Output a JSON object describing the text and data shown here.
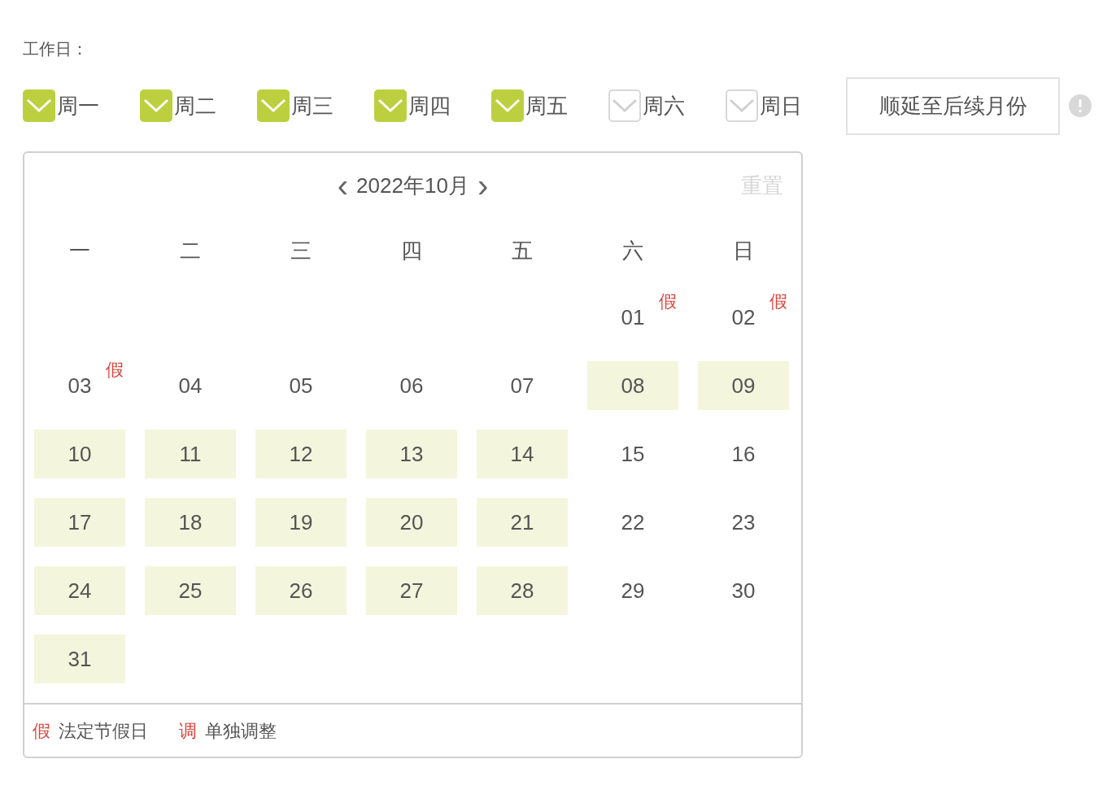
{
  "workdays_label": "工作日：",
  "weekday_options": [
    {
      "label": "周一",
      "checked": true
    },
    {
      "label": "周二",
      "checked": true
    },
    {
      "label": "周三",
      "checked": true
    },
    {
      "label": "周四",
      "checked": true
    },
    {
      "label": "周五",
      "checked": true
    },
    {
      "label": "周六",
      "checked": false
    },
    {
      "label": "周日",
      "checked": false
    }
  ],
  "extend_button": "顺延至后续月份",
  "calendar": {
    "prev": "‹",
    "title": "2022年10月",
    "next": "›",
    "reset": "重置",
    "weekdays": [
      "一",
      "二",
      "三",
      "四",
      "五",
      "六",
      "日"
    ],
    "weeks": [
      [
        {
          "kind": "blank"
        },
        {
          "kind": "blank"
        },
        {
          "kind": "blank"
        },
        {
          "kind": "blank"
        },
        {
          "kind": "blank"
        },
        {
          "kind": "day",
          "day": "01",
          "workday": false,
          "badge": "假"
        },
        {
          "kind": "day",
          "day": "02",
          "workday": false,
          "badge": "假"
        }
      ],
      [
        {
          "kind": "day",
          "day": "03",
          "workday": false,
          "badge": "假"
        },
        {
          "kind": "day",
          "day": "04",
          "workday": false
        },
        {
          "kind": "day",
          "day": "05",
          "workday": false
        },
        {
          "kind": "day",
          "day": "06",
          "workday": false
        },
        {
          "kind": "day",
          "day": "07",
          "workday": false
        },
        {
          "kind": "day",
          "day": "08",
          "workday": true
        },
        {
          "kind": "day",
          "day": "09",
          "workday": true
        }
      ],
      [
        {
          "kind": "day",
          "day": "10",
          "workday": true
        },
        {
          "kind": "day",
          "day": "11",
          "workday": true
        },
        {
          "kind": "day",
          "day": "12",
          "workday": true
        },
        {
          "kind": "day",
          "day": "13",
          "workday": true
        },
        {
          "kind": "day",
          "day": "14",
          "workday": true
        },
        {
          "kind": "day",
          "day": "15",
          "workday": false
        },
        {
          "kind": "day",
          "day": "16",
          "workday": false
        }
      ],
      [
        {
          "kind": "day",
          "day": "17",
          "workday": true
        },
        {
          "kind": "day",
          "day": "18",
          "workday": true
        },
        {
          "kind": "day",
          "day": "19",
          "workday": true
        },
        {
          "kind": "day",
          "day": "20",
          "workday": true
        },
        {
          "kind": "day",
          "day": "21",
          "workday": true
        },
        {
          "kind": "day",
          "day": "22",
          "workday": false
        },
        {
          "kind": "day",
          "day": "23",
          "workday": false
        }
      ],
      [
        {
          "kind": "day",
          "day": "24",
          "workday": true
        },
        {
          "kind": "day",
          "day": "25",
          "workday": true
        },
        {
          "kind": "day",
          "day": "26",
          "workday": true
        },
        {
          "kind": "day",
          "day": "27",
          "workday": true
        },
        {
          "kind": "day",
          "day": "28",
          "workday": true
        },
        {
          "kind": "day",
          "day": "29",
          "workday": false
        },
        {
          "kind": "day",
          "day": "30",
          "workday": false
        }
      ],
      [
        {
          "kind": "day",
          "day": "31",
          "workday": true
        }
      ]
    ],
    "legend": [
      {
        "mark": "假",
        "label": "法定节假日"
      },
      {
        "mark": "调",
        "label": "单独调整"
      }
    ]
  }
}
